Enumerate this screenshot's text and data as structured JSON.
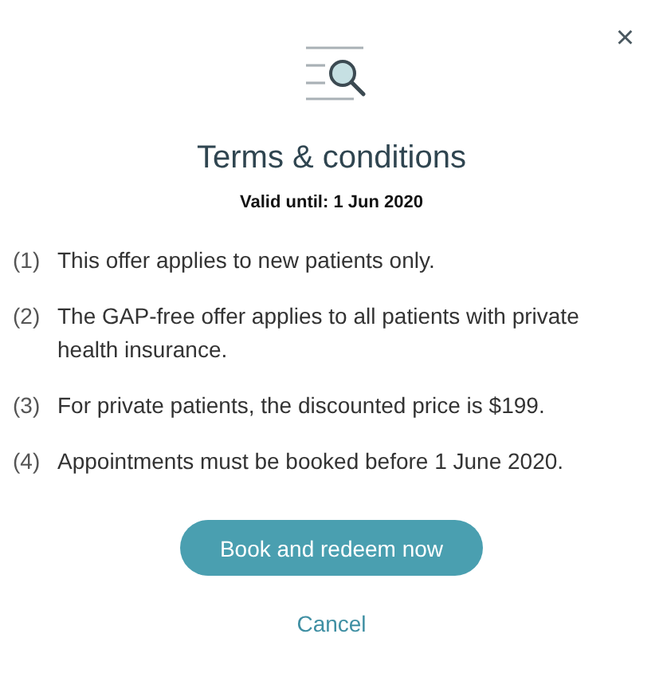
{
  "close_button": "×",
  "title": "Terms & conditions",
  "validity": "Valid until: 1 Jun 2020",
  "terms": [
    {
      "number": "(1)",
      "text": "This offer applies to new patients only."
    },
    {
      "number": "(2)",
      "text": "The GAP-free offer applies to all patients with private health insurance."
    },
    {
      "number": "(3)",
      "text": "For private patients, the discounted price is $199."
    },
    {
      "number": "(4)",
      "text": "Appointments must be booked before 1 June 2020."
    }
  ],
  "primary_button": "Book and redeem now",
  "cancel_link": "Cancel"
}
